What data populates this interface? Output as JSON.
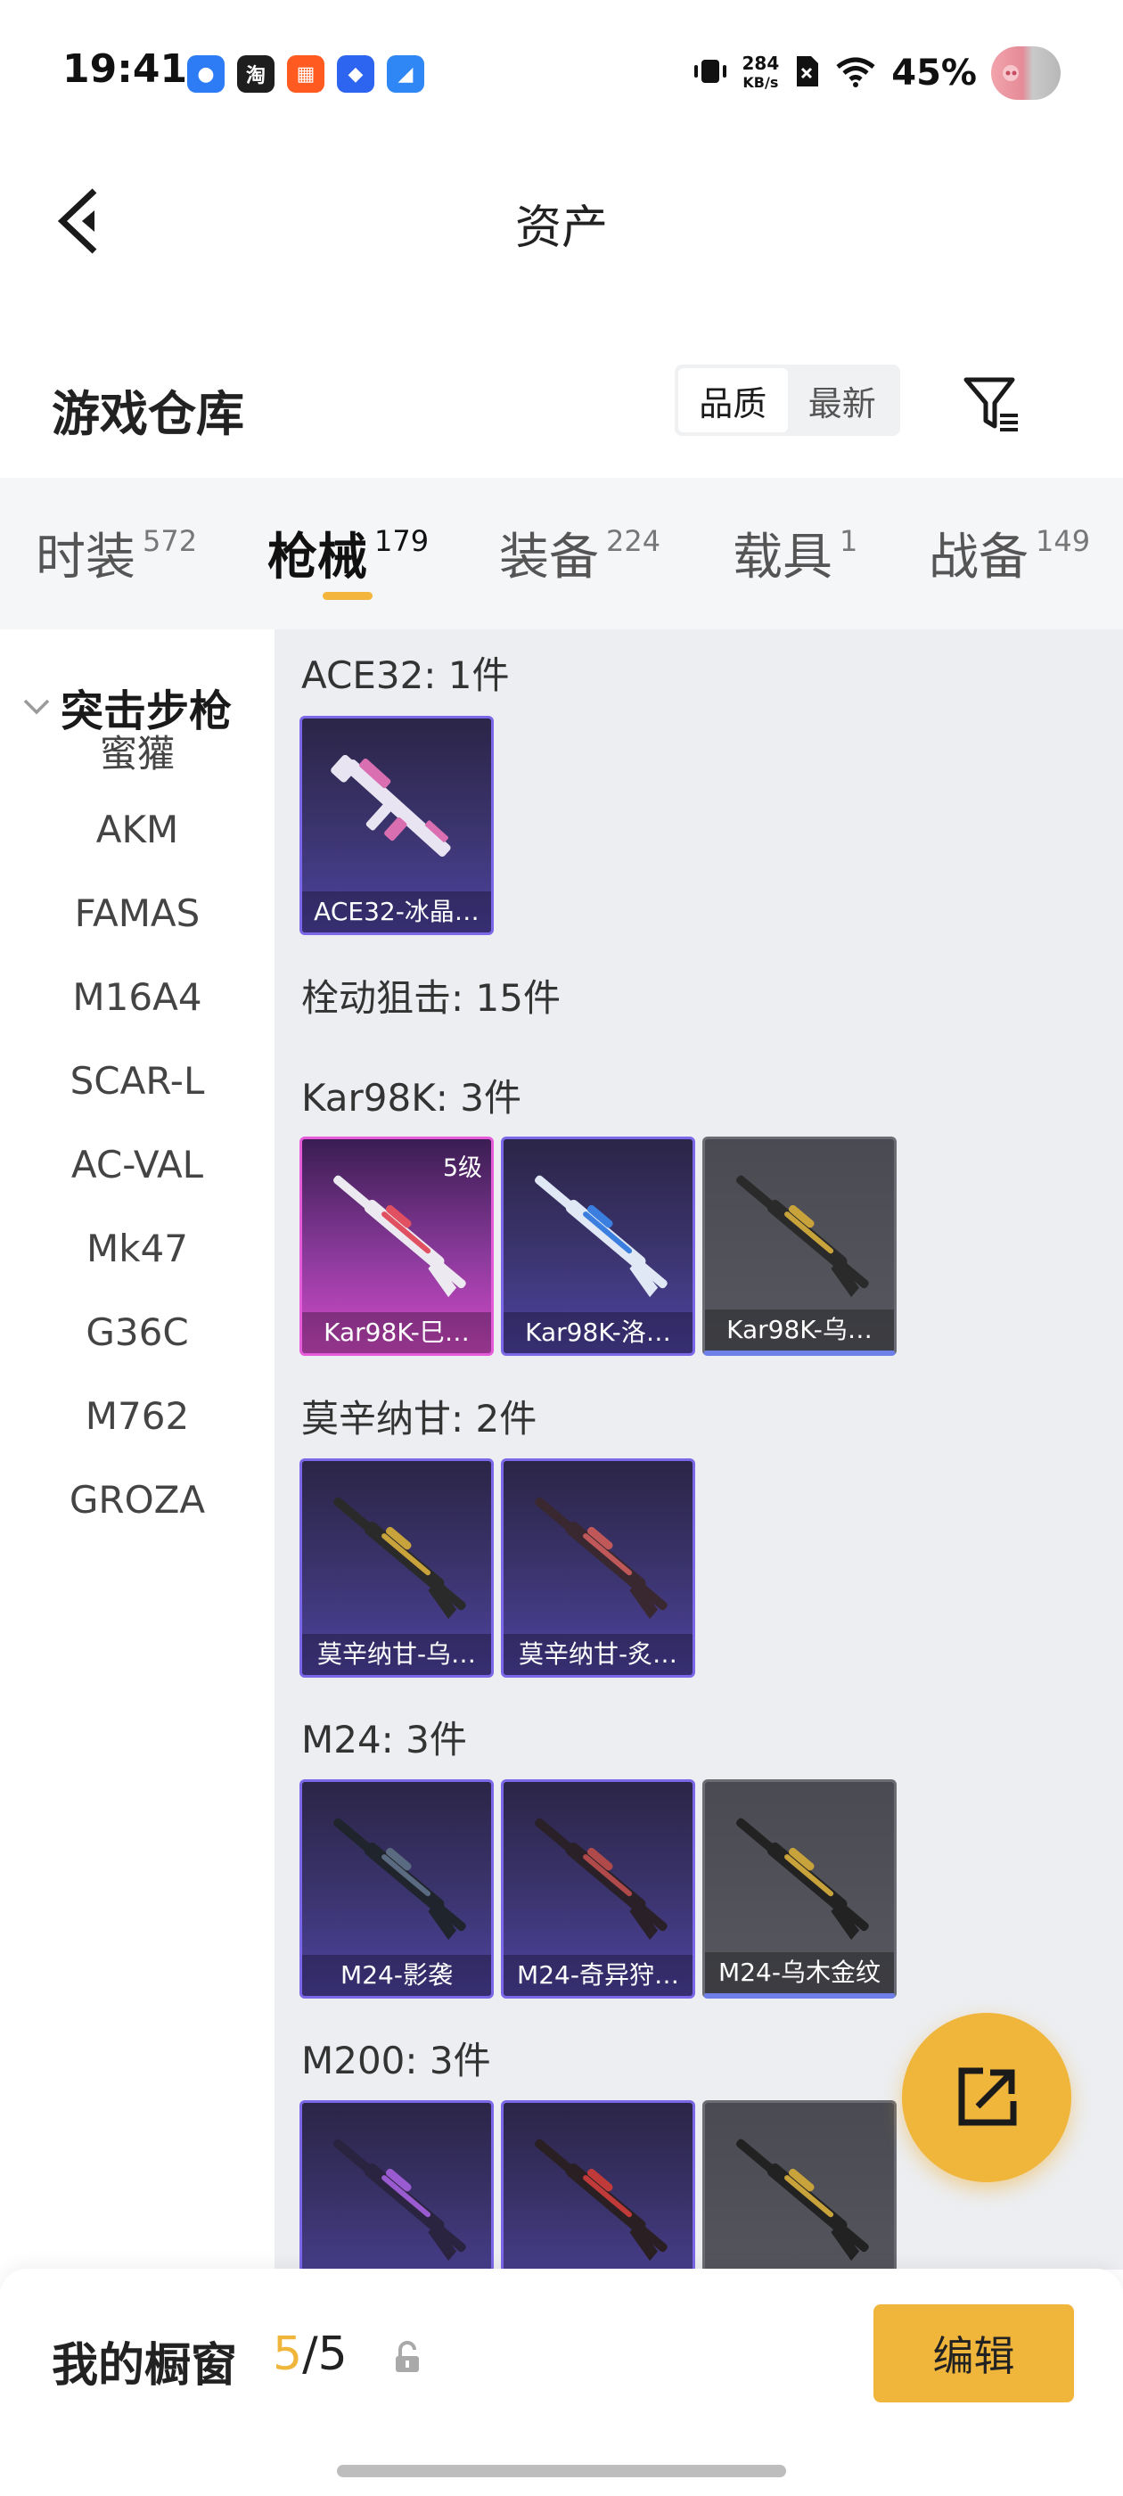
{
  "status_bar": {
    "time": "19:41",
    "apps": [
      {
        "icon": "chat-bubble-icon",
        "color": "#2d7cf6",
        "glyph": "●"
      },
      {
        "icon": "taobao-icon",
        "color": "#1e1e1e",
        "glyph": "淘"
      },
      {
        "icon": "grid-app-icon",
        "color": "#ff5a1f",
        "glyph": "▦"
      },
      {
        "icon": "diamond-app-icon",
        "color": "#2d64f0",
        "glyph": "◆"
      },
      {
        "icon": "browser-app-icon",
        "color": "#2f86f5",
        "glyph": "◢"
      }
    ],
    "net_speed_value": "284",
    "net_speed_unit": "KB/s",
    "battery": "45%"
  },
  "header": {
    "title": "资产"
  },
  "warehouse": {
    "title": "游戏仓库",
    "sort_options": [
      {
        "label": "品质",
        "active": true
      },
      {
        "label": "最新",
        "active": false
      }
    ]
  },
  "tabs": [
    {
      "label": "时装",
      "count": "572",
      "active": false
    },
    {
      "label": "枪械",
      "count": "179",
      "active": true
    },
    {
      "label": "装备",
      "count": "224",
      "active": false
    },
    {
      "label": "载具",
      "count": "1",
      "active": false
    },
    {
      "label": "战备",
      "count": "149",
      "active": false
    }
  ],
  "sidebar": {
    "group_label": "突击步枪",
    "items": [
      "蜜獾",
      "AKM",
      "FAMAS",
      "M16A4",
      "SCAR-L",
      "AC-VAL",
      "Mk47",
      "G36C",
      "M762",
      "GROZA"
    ]
  },
  "content": {
    "sections": [
      {
        "title": "ACE32: 1件",
        "cards": [
          {
            "label": "ACE32-冰晶…",
            "rarity": "purple",
            "gun_color": "#e9e4f2",
            "accent": "#d96fb0"
          }
        ]
      },
      {
        "title": "栓动狙击: 15件",
        "cards": []
      },
      {
        "title": "Kar98K: 3件",
        "cards": [
          {
            "label": "Kar98K-巳…",
            "rarity": "pink",
            "level": "5级",
            "gun_color": "#eceaf0",
            "accent": "#e05060"
          },
          {
            "label": "Kar98K-洛…",
            "rarity": "purple",
            "gun_color": "#dfe8f4",
            "accent": "#3a7fe0"
          },
          {
            "label": "Kar98K-乌…",
            "rarity": "grey",
            "gun_color": "#2a2a2a",
            "accent": "#c8a23a"
          }
        ]
      },
      {
        "title": "莫辛纳甘: 2件",
        "cards": [
          {
            "label": "莫辛纳甘-乌…",
            "rarity": "purple",
            "gun_color": "#2a2a2a",
            "accent": "#c8a23a"
          },
          {
            "label": "莫辛纳甘-炙…",
            "rarity": "purple",
            "gun_color": "#3a2830",
            "accent": "#c0585a"
          }
        ]
      },
      {
        "title": "M24: 3件",
        "cards": [
          {
            "label": "M24-影袭",
            "rarity": "purple",
            "gun_color": "#20242c",
            "accent": "#5a6a80"
          },
          {
            "label": "M24-奇异狩…",
            "rarity": "purple",
            "gun_color": "#2a2028",
            "accent": "#b04a4a"
          },
          {
            "label": "M24-乌木金纹",
            "rarity": "grey",
            "gun_color": "#222222",
            "accent": "#c8a23a"
          }
        ]
      },
      {
        "title": "M200: 3件",
        "cards": [
          {
            "label": "",
            "rarity": "purple",
            "gun_color": "#2a2440",
            "accent": "#9a5ad0"
          },
          {
            "label": "",
            "rarity": "purple",
            "gun_color": "#2a2024",
            "accent": "#c03a3a"
          },
          {
            "label": "",
            "rarity": "grey",
            "gun_color": "#222222",
            "accent": "#c8a23a"
          }
        ]
      }
    ]
  },
  "showcase": {
    "label": "我的橱窗",
    "current": "5",
    "separator": "/",
    "total": "5",
    "edit_label": "编辑"
  },
  "colors": {
    "accent": "#f0b63c",
    "purple_border": "#7b68e8",
    "pink_border": "#e65bd9"
  }
}
